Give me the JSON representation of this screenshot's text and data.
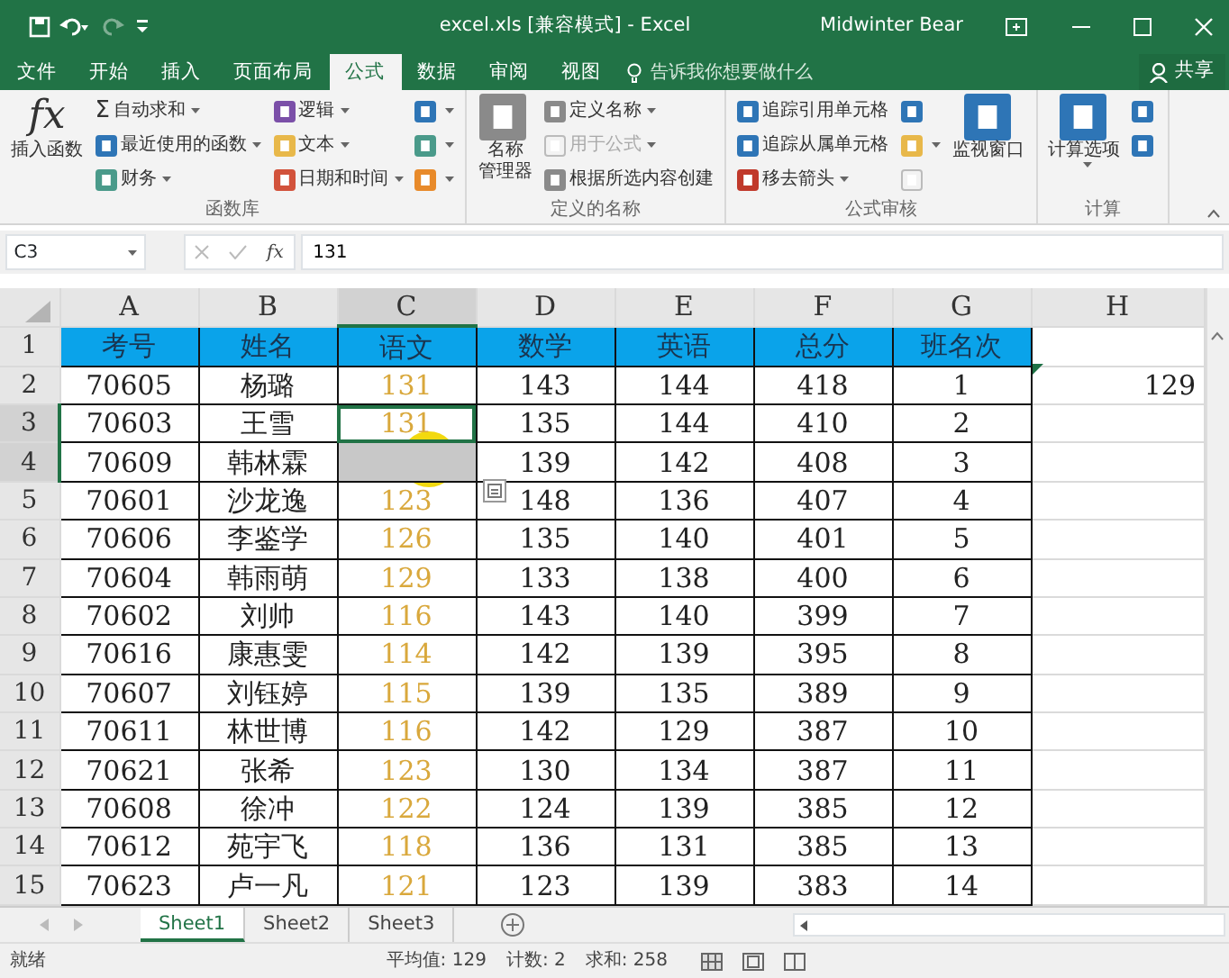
{
  "window": {
    "title": "excel.xls [兼容模式] - Excel",
    "user": "Midwinter Bear"
  },
  "tabs": [
    {
      "label": "文件",
      "selected": false
    },
    {
      "label": "开始",
      "selected": false
    },
    {
      "label": "插入",
      "selected": false
    },
    {
      "label": "页面布局",
      "selected": false
    },
    {
      "label": "公式",
      "selected": true
    },
    {
      "label": "数据",
      "selected": false
    },
    {
      "label": "审阅",
      "selected": false
    },
    {
      "label": "视图",
      "selected": false
    }
  ],
  "tell_me": {
    "placeholder": "告诉我你想要做什么"
  },
  "share": {
    "label": "共享"
  },
  "ribbon": [
    {
      "label": "函数库",
      "columns": [
        [
          {
            "kind": "large",
            "glyph": "fx",
            "label": "插入函数",
            "dropdown": false,
            "disabled": false
          }
        ],
        [
          {
            "kind": "small",
            "glyph": "Σ",
            "label": "自动求和",
            "dropdown": true,
            "disabled": false
          },
          {
            "kind": "small",
            "color": "#2e75b6",
            "label": "最近使用的函数",
            "dropdown": true,
            "disabled": false
          },
          {
            "kind": "small",
            "color": "#4a9a8a",
            "label": "财务",
            "dropdown": true,
            "disabled": false
          }
        ],
        [
          {
            "kind": "small",
            "color": "#7b4fa8",
            "label": "逻辑",
            "dropdown": true,
            "disabled": false
          },
          {
            "kind": "small",
            "color": "#e8b84a",
            "label": "文本",
            "dropdown": true,
            "disabled": false
          },
          {
            "kind": "small",
            "color": "#d2523b",
            "label": "日期和时间",
            "dropdown": true,
            "disabled": false
          }
        ],
        [
          {
            "kind": "icon",
            "color": "#2e75b6",
            "dropdown": true,
            "disabled": false
          },
          {
            "kind": "icon",
            "color": "#4a9a8a",
            "dropdown": true,
            "disabled": false
          },
          {
            "kind": "icon",
            "color": "#e88a2a",
            "dropdown": true,
            "disabled": false
          }
        ]
      ]
    },
    {
      "label": "定义的名称",
      "columns": [
        [
          {
            "kind": "large",
            "color": "#8a8a8a",
            "label": [
              "名称",
              "管理器"
            ],
            "dropdown": false,
            "disabled": false
          }
        ],
        [
          {
            "kind": "small",
            "color": "#8a8a8a",
            "label": "定义名称",
            "dropdown": true,
            "disabled": false
          },
          {
            "kind": "small",
            "label": "用于公式",
            "dropdown": true,
            "disabled": true
          },
          {
            "kind": "small",
            "color": "#8a8a8a",
            "label": "根据所选内容创建",
            "dropdown": false,
            "disabled": false
          }
        ]
      ]
    },
    {
      "label": "公式审核",
      "columns": [
        [
          {
            "kind": "small",
            "color": "#2e75b6",
            "label": "追踪引用单元格",
            "dropdown": false,
            "disabled": false
          },
          {
            "kind": "small",
            "color": "#2e75b6",
            "label": "追踪从属单元格",
            "dropdown": false,
            "disabled": false
          },
          {
            "kind": "small",
            "color": "#c0392b",
            "label": "移去箭头",
            "dropdown": true,
            "disabled": false
          }
        ],
        [
          {
            "kind": "icon",
            "color": "#2e75b6",
            "dropdown": false,
            "disabled": false
          },
          {
            "kind": "icon",
            "color": "#e8b84a",
            "dropdown": true,
            "disabled": false
          },
          {
            "kind": "icon",
            "dropdown": false,
            "disabled": true
          }
        ],
        [
          {
            "kind": "large",
            "color": "#2e75b6",
            "label": "监视窗口",
            "dropdown": false,
            "disabled": false
          }
        ]
      ]
    },
    {
      "label": "计算",
      "columns": [
        [
          {
            "kind": "large",
            "color": "#2e75b6",
            "label": "计算选项",
            "dropdown": true,
            "disabled": false
          }
        ],
        [
          {
            "kind": "icon",
            "color": "#2e75b6",
            "dropdown": false,
            "disabled": false
          },
          {
            "kind": "icon",
            "color": "#2e75b6",
            "dropdown": false,
            "disabled": false
          }
        ]
      ]
    }
  ],
  "formula_bar": {
    "name_box": "C3",
    "fx": "fx",
    "value": "131"
  },
  "columns": [
    {
      "letter": "A",
      "selected": false,
      "color": "#222222"
    },
    {
      "letter": "B",
      "selected": false,
      "color": "#222222"
    },
    {
      "letter": "C",
      "selected": true,
      "color": "#d9a83c"
    },
    {
      "letter": "D",
      "selected": false,
      "color": "#222222"
    },
    {
      "letter": "E",
      "selected": false,
      "color": "#222222"
    },
    {
      "letter": "F",
      "selected": false,
      "color": "#222222"
    },
    {
      "letter": "G",
      "selected": false,
      "color": "#222222"
    },
    {
      "letter": "H",
      "selected": false,
      "color": "#222222"
    }
  ],
  "rows": [
    {
      "number": "1",
      "selected": false,
      "kind": "header",
      "cells": [
        "考号",
        "姓名",
        "语文",
        "数学",
        "英语",
        "总分",
        "班名次"
      ]
    },
    {
      "number": "2",
      "selected": false,
      "kind": "data",
      "cells": [
        "70605",
        "杨璐",
        "131",
        "143",
        "144",
        "418",
        "1"
      ],
      "h": "129"
    },
    {
      "number": "3",
      "selected": true,
      "kind": "data",
      "cells": [
        "70603",
        "王雪",
        "131",
        "135",
        "144",
        "410",
        "2"
      ]
    },
    {
      "number": "4",
      "selected": true,
      "kind": "data",
      "cells": [
        "70609",
        "韩林霖",
        null,
        "139",
        "142",
        "408",
        "3"
      ]
    },
    {
      "number": "5",
      "selected": false,
      "kind": "data",
      "cells": [
        "70601",
        "沙龙逸",
        "123",
        "148",
        "136",
        "407",
        "4"
      ]
    },
    {
      "number": "6",
      "selected": false,
      "kind": "data",
      "cells": [
        "70606",
        "李鉴学",
        "126",
        "135",
        "140",
        "401",
        "5"
      ]
    },
    {
      "number": "7",
      "selected": false,
      "kind": "data",
      "cells": [
        "70604",
        "韩雨萌",
        "129",
        "133",
        "138",
        "400",
        "6"
      ]
    },
    {
      "number": "8",
      "selected": false,
      "kind": "data",
      "cells": [
        "70602",
        "刘帅",
        "116",
        "143",
        "140",
        "399",
        "7"
      ]
    },
    {
      "number": "9",
      "selected": false,
      "kind": "data",
      "cells": [
        "70616",
        "康惠雯",
        "114",
        "142",
        "139",
        "395",
        "8"
      ]
    },
    {
      "number": "10",
      "selected": false,
      "kind": "data",
      "cells": [
        "70607",
        "刘钰婷",
        "115",
        "139",
        "135",
        "389",
        "9"
      ]
    },
    {
      "number": "11",
      "selected": false,
      "kind": "data",
      "cells": [
        "70611",
        "林世博",
        "116",
        "142",
        "129",
        "387",
        "10"
      ]
    },
    {
      "number": "12",
      "selected": false,
      "kind": "data",
      "cells": [
        "70621",
        "张希",
        "123",
        "130",
        "134",
        "387",
        "11"
      ]
    },
    {
      "number": "13",
      "selected": false,
      "kind": "data",
      "cells": [
        "70608",
        "徐冲",
        "122",
        "124",
        "139",
        "385",
        "12"
      ]
    },
    {
      "number": "14",
      "selected": false,
      "kind": "data",
      "cells": [
        "70612",
        "苑宇飞",
        "118",
        "136",
        "131",
        "385",
        "13"
      ]
    },
    {
      "number": "15",
      "selected": false,
      "kind": "data",
      "cells": [
        "70623",
        "卢一凡",
        "121",
        "123",
        "139",
        "383",
        "14"
      ]
    }
  ],
  "sheets": [
    {
      "label": "Sheet1",
      "selected": true
    },
    {
      "label": "Sheet2",
      "selected": false
    },
    {
      "label": "Sheet3",
      "selected": false
    }
  ],
  "status_bar": {
    "state": "就绪",
    "stats": [
      "平均值: 129",
      "计数: 2",
      "求和: 258"
    ]
  }
}
